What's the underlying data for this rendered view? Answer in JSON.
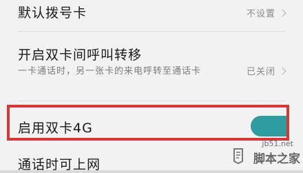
{
  "settings": {
    "default_dial_card": {
      "title": "默认拨号卡",
      "value": "不设置"
    },
    "call_forwarding": {
      "title": "开启双卡间呼叫转移",
      "description": "一卡通话时，另一张卡的来电呼转至通话卡",
      "value": "已关闭"
    },
    "dual_4g": {
      "title": "启用双卡4G",
      "toggle_state": "on",
      "toggle_color": "#2f9c9f"
    },
    "online_during_call": {
      "title": "通话时可上网"
    }
  },
  "highlight": {
    "color": "#d23a36"
  },
  "watermark": {
    "url": "jb51.net",
    "site": "脚本之家"
  }
}
